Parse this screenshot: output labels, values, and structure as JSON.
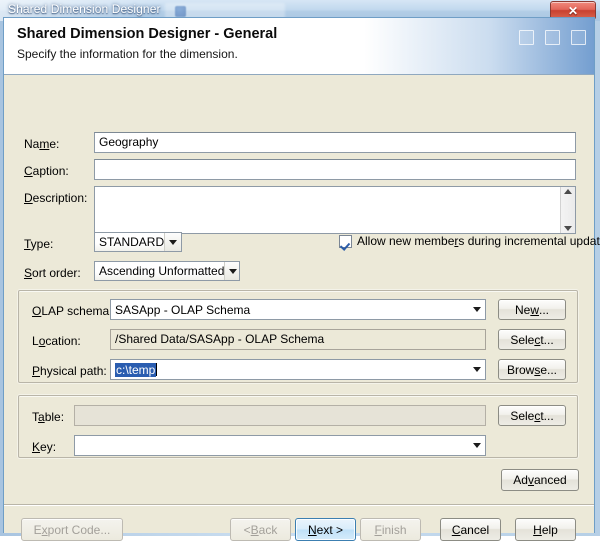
{
  "window": {
    "title": "Shared Dimension Designer",
    "close_label": "✕"
  },
  "header": {
    "title": "Shared Dimension Designer - General",
    "subtitle": "Specify the information for the dimension."
  },
  "form": {
    "name": {
      "label_pre": "Na",
      "label_mn": "m",
      "label_post": "e:",
      "value": "Geography"
    },
    "caption": {
      "label_pre": "",
      "label_mn": "C",
      "label_post": "aption:",
      "value": ""
    },
    "description": {
      "label_pre": "",
      "label_mn": "D",
      "label_post": "escription:",
      "value": ""
    },
    "type": {
      "label_pre": "",
      "label_mn": "T",
      "label_post": "ype:",
      "value": "STANDARD"
    },
    "sort_order": {
      "label_pre": "",
      "label_mn": "S",
      "label_post": "ort order:",
      "value": "Ascending Unformatted"
    },
    "allow_new_members": {
      "label_pre": "Allow new membe",
      "label_mn": "r",
      "label_post": "s during incremental update",
      "checked": true
    }
  },
  "olap_group": {
    "schema": {
      "label_pre": "",
      "label_mn": "O",
      "label_post": "LAP schema:",
      "value": "SASApp - OLAP Schema"
    },
    "location": {
      "label_pre": "L",
      "label_mn": "o",
      "label_post": "cation:",
      "value": "/Shared Data/SASApp - OLAP Schema"
    },
    "physical_path": {
      "label_pre": "",
      "label_mn": "P",
      "label_post": "hysical path:",
      "value": "c:\\temp",
      "selected": true
    },
    "buttons": {
      "new": {
        "pre": "Ne",
        "mn": "w",
        "post": "..."
      },
      "select": {
        "pre": "Sele",
        "mn": "c",
        "post": "t..."
      },
      "browse": {
        "pre": "Brow",
        "mn": "s",
        "post": "e..."
      }
    }
  },
  "table_group": {
    "table": {
      "label_pre": "T",
      "label_mn": "a",
      "label_post": "ble:",
      "value": "",
      "disabled": true
    },
    "key": {
      "label_pre": "",
      "label_mn": "K",
      "label_post": "ey:",
      "value": ""
    },
    "select_button": {
      "pre": "Sele",
      "mn": "c",
      "post": "t..."
    }
  },
  "advanced_button": {
    "pre": "Ad",
    "mn": "v",
    "post": "anced"
  },
  "footer": {
    "export_code": {
      "pre": "E",
      "mn": "x",
      "post": "port Code...",
      "disabled": true
    },
    "back": {
      "pre": "< ",
      "mn": "B",
      "post": "ack",
      "disabled": true
    },
    "next": {
      "pre": "",
      "mn": "N",
      "post": "ext >",
      "default": true
    },
    "finish": {
      "pre": "",
      "mn": "F",
      "post": "inish",
      "disabled": true
    },
    "cancel": {
      "pre": "",
      "mn": "C",
      "post": "ancel"
    },
    "help": {
      "pre": "",
      "mn": "H",
      "post": "elp"
    }
  },
  "colors": {
    "dialog_bg": "#ece9d8",
    "accent_blue": "#3c7fb1",
    "selection_blue": "#2a5db0",
    "close_red": "#c8412f"
  }
}
